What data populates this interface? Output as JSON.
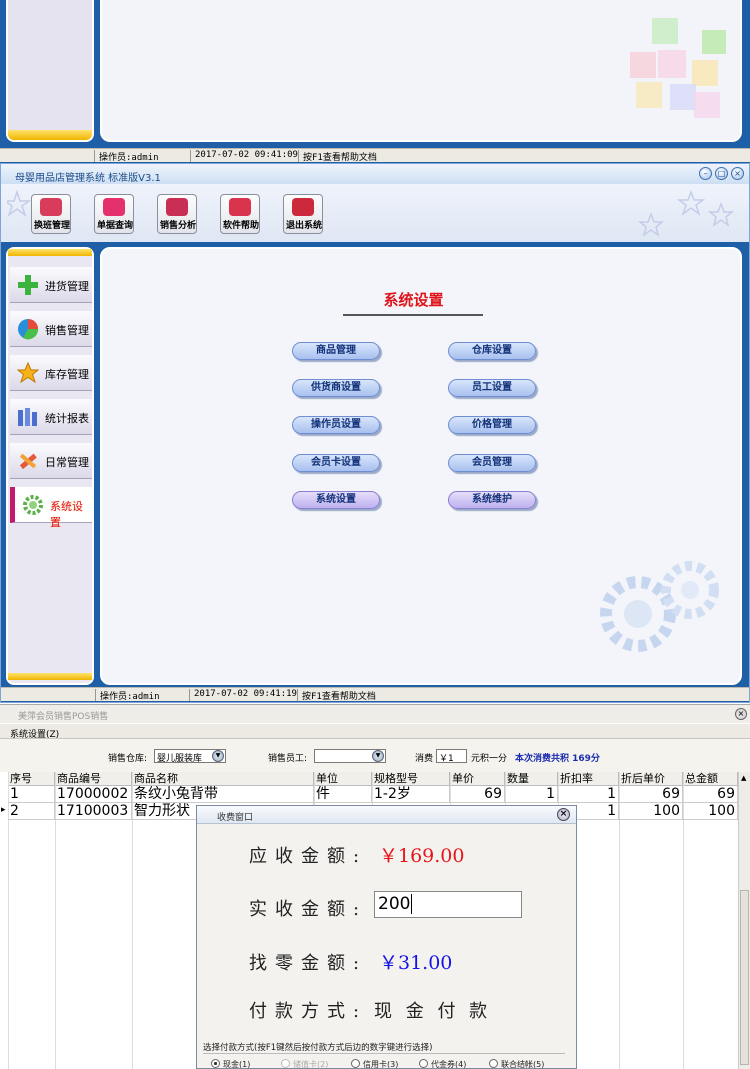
{
  "window1": {
    "status": {
      "operator": "操作员:admin",
      "datetime": "2017-07-02 09:41:09",
      "help": "按F1查看帮助文档"
    }
  },
  "window2": {
    "title": "母婴用品店管理系统 标准版V3.1",
    "toolbar": [
      {
        "label": "换班管理",
        "icon": "shift-icon",
        "color": "#d83c5a"
      },
      {
        "label": "单据查询",
        "icon": "search-icon",
        "color": "#e4306c"
      },
      {
        "label": "销售分析",
        "icon": "bar-chart-icon",
        "color": "#c92f55"
      },
      {
        "label": "软件帮助",
        "icon": "help-icon",
        "color": "#d8344d"
      },
      {
        "label": "退出系统",
        "icon": "power-icon",
        "color": "#cc2a3c"
      }
    ],
    "sidebar": [
      {
        "label": "进货管理",
        "icon": "plus-icon"
      },
      {
        "label": "销售管理",
        "icon": "pie-icon"
      },
      {
        "label": "库存管理",
        "icon": "star-icon"
      },
      {
        "label": "统计报表",
        "icon": "report-icon"
      },
      {
        "label": "日常管理",
        "icon": "tools-icon"
      },
      {
        "label": "系统设置",
        "icon": "gear-icon",
        "active": true
      }
    ],
    "heading": "系统设置",
    "settings": [
      [
        "商品管理",
        "仓库设置"
      ],
      [
        "供货商设置",
        "员工设置"
      ],
      [
        "操作员设置",
        "价格管理"
      ],
      [
        "会员卡设置",
        "会员管理"
      ],
      [
        "系统设置",
        "系统维护"
      ]
    ],
    "status": {
      "operator": "操作员:admin",
      "datetime": "2017-07-02 09:41:19",
      "help": "按F1查看帮助文档"
    }
  },
  "window3": {
    "title": "美萍会员销售POS销售",
    "menu": "系统设置(Z)",
    "filter": {
      "warehouse_label": "销售仓库:",
      "warehouse_value": "婴儿服装库",
      "staff_label": "销售员工:",
      "staff_value": "",
      "consume_label": "消费",
      "consume_value": "￥1",
      "points_suffix": "元积一分",
      "total_note": "本次消费共积 169分"
    },
    "columns": [
      "序号",
      "商品编号",
      "商品名称",
      "单位",
      "规格型号",
      "单价",
      "数量",
      "折扣率",
      "折后单价",
      "总金额"
    ],
    "rows": [
      [
        "1",
        "17000002",
        "条纹小兔背带",
        "件",
        "1-2岁",
        "69",
        "1",
        "1",
        "69",
        "69"
      ],
      [
        "2",
        "17100003",
        "智力形状",
        "",
        "",
        "",
        "",
        "1",
        "100",
        "100"
      ]
    ],
    "current_row_marker": "▸"
  },
  "dialog": {
    "title": "收费窗口",
    "due_label": "应收金额:",
    "due_value": "￥169.00",
    "paid_label": "实收金额:",
    "paid_value": "200",
    "change_label": "找零金额:",
    "change_value": "￥31.00",
    "method_label": "付款方式:",
    "method_value": "现 金 付 款",
    "hint": "选择付款方式(按F1键然后按付款方式后边的数字键进行选择)",
    "methods": [
      {
        "label": "现金(1)",
        "selected": true,
        "enabled": true
      },
      {
        "label": "储值卡(2)",
        "selected": false,
        "enabled": false
      },
      {
        "label": "信用卡(3)",
        "selected": false,
        "enabled": true
      },
      {
        "label": "代金券(4)",
        "selected": false,
        "enabled": true
      },
      {
        "label": "联合结帐(5)",
        "selected": false,
        "enabled": true
      }
    ],
    "colors": {
      "due": "#e8141b",
      "change": "#1414e8"
    }
  }
}
